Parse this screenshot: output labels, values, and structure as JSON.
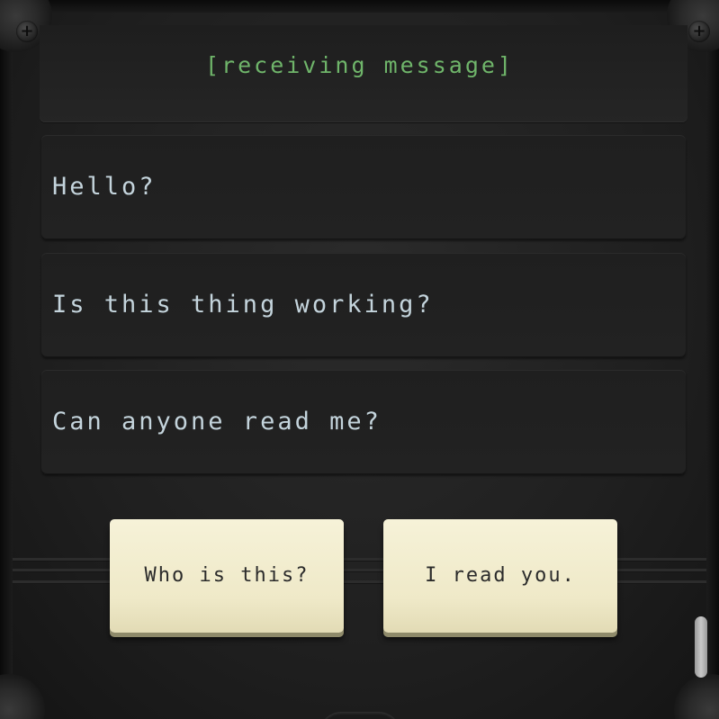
{
  "header": {
    "title": "[receiving message]"
  },
  "messages": [
    {
      "text": "Hello?"
    },
    {
      "text": "Is this thing working?"
    },
    {
      "text": "Can anyone read me?"
    }
  ],
  "choices": [
    {
      "label": "Who is this?"
    },
    {
      "label": "I read you."
    }
  ],
  "colors": {
    "header_text": "#6fb56a",
    "message_text": "#c4d4dc",
    "choice_bg": "#f6f2d8",
    "panel_bg": "#222222"
  },
  "icons": {
    "corner_screw": "plus-screw-icon"
  }
}
